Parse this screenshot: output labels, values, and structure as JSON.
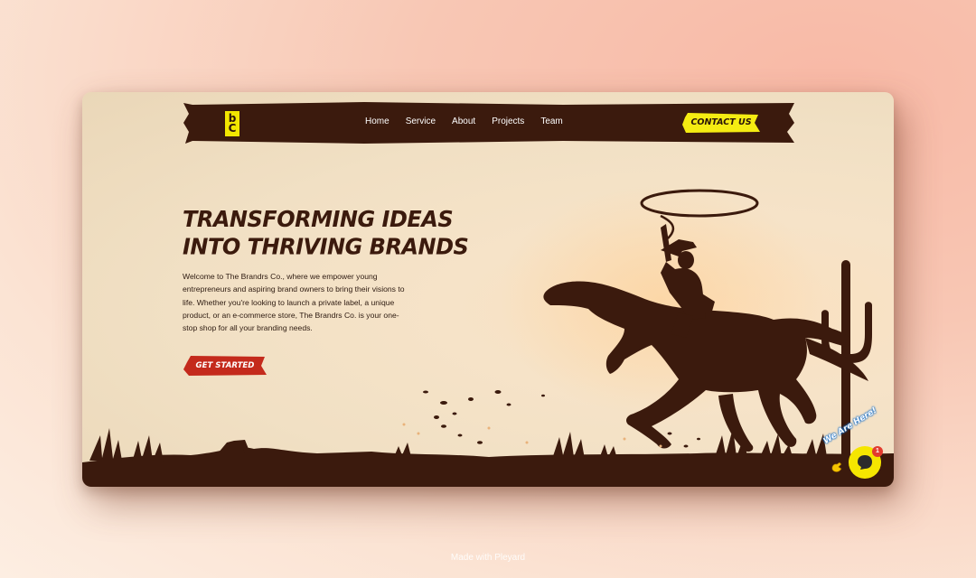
{
  "brand": {
    "logo_top": "b",
    "logo_bottom": "C"
  },
  "nav": {
    "items": [
      {
        "label": "Home"
      },
      {
        "label": "Service"
      },
      {
        "label": "About"
      },
      {
        "label": "Projects"
      },
      {
        "label": "Team"
      }
    ],
    "contact_label": "CONTACT US"
  },
  "hero": {
    "title": "TRANSFORMING IDEAS INTO THRIVING BRANDS",
    "description": "Welcome to The Brandrs Co., where we empower young entrepreneurs and aspiring brand owners to bring their visions to life. Whether you're looking to launch a private label, a unique product, or an e-commerce store, The Brandrs Co. is your one-stop shop for all your branding needs.",
    "cta_label": "GET STARTED"
  },
  "chat": {
    "label": "We Are Here!",
    "badge_count": "1"
  },
  "footer": {
    "credit": "Made with Pleyard"
  },
  "colors": {
    "dark_brown": "#3b1a0d",
    "accent_yellow": "#f5ec12",
    "accent_red": "#c42a1c",
    "paper": "#f1e0c4"
  },
  "icons": [
    "chat-icon",
    "hand-wave-icon"
  ]
}
